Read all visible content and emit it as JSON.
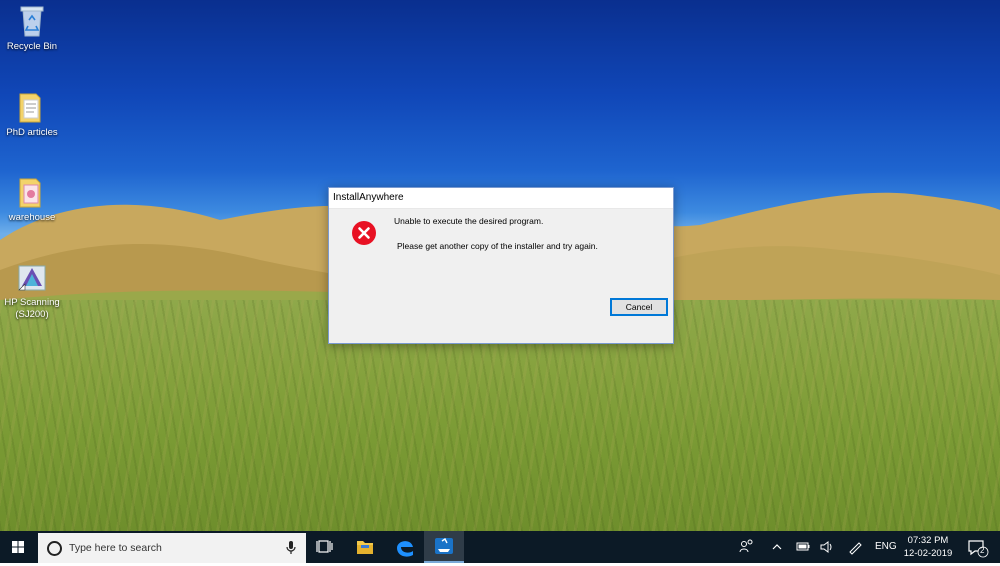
{
  "desktop": {
    "icons": [
      {
        "label": "Recycle Bin"
      },
      {
        "label": "PhD articles"
      },
      {
        "label": "warehouse"
      },
      {
        "label": "HP Scanning (SJ200)"
      }
    ]
  },
  "dialog": {
    "title": "InstallAnywhere",
    "message_line1": "Unable to execute the desired program.",
    "message_line2": "Please get another copy of the installer and try again.",
    "cancel_label": "Cancel",
    "icon": "error-x-icon"
  },
  "taskbar": {
    "search_placeholder": "Type here to search",
    "apps": [
      "task-view-icon",
      "file-explorer-icon",
      "edge-icon",
      "installer-icon"
    ],
    "tray": {
      "language": "ENG",
      "time": "07:32 PM",
      "date": "12-02-2019",
      "notification_count": "2"
    }
  },
  "colors": {
    "taskbar_bg": "#0c1a26",
    "dialog_bg": "#f0f0f0",
    "accent": "#0078d7",
    "error_red": "#e81123"
  }
}
